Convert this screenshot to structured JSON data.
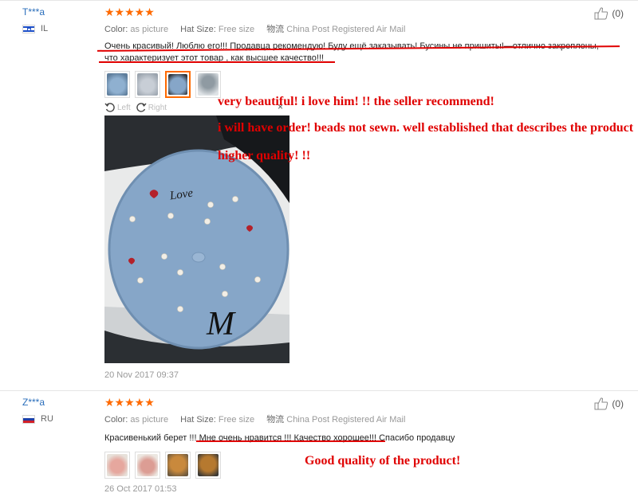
{
  "reviews": [
    {
      "user": "T***a",
      "country_code": "IL",
      "flag": "israel-flag-icon",
      "stars": "★★★★★",
      "color_label": "Color:",
      "color_value": "as picture",
      "hat_label": "Hat Size:",
      "hat_value": "Free size",
      "shipping_label": "物流",
      "shipping_value": "China Post Registered Air Mail",
      "feedback_line1": "Очень красивый! Люблю его!!! Продавца рекомендую! Буду ещё заказывать! Бусины не пришиты!—отлично закреплены,",
      "feedback_line2": "что характеризует этот товар , как высшее качество!!!",
      "helpful_count": "(0)",
      "viewer_left": "Left",
      "viewer_right": "Right",
      "viewer_close": "×",
      "date": "20 Nov 2017 09:37",
      "photo_text": "Love",
      "photo_letter": "M",
      "annotations": [
        "very beautiful! i love him! !! the seller recommend!",
        "i will have order! beads not sewn. well established that describes the product",
        "higher quality! !!"
      ]
    },
    {
      "user": "Z***a",
      "country_code": "RU",
      "flag": "russia-flag-icon",
      "stars": "★★★★★",
      "color_label": "Color:",
      "color_value": "as picture",
      "hat_label": "Hat Size:",
      "hat_value": "Free size",
      "shipping_label": "物流",
      "shipping_value": "China Post Registered Air Mail",
      "feedback_line1": "Красивенький берет !!! Мне очень нравится !!! Качество хорошее!!! Спасибо продавцу",
      "helpful_count": "(0)",
      "date": "26 Oct 2017 01:53",
      "annotations": [
        "Good quality of the product!"
      ]
    }
  ],
  "colors": {
    "accent_star": "#ff6a00",
    "link": "#2a6ebb",
    "annotation": "#e00000",
    "beret": "#86a6c8"
  }
}
